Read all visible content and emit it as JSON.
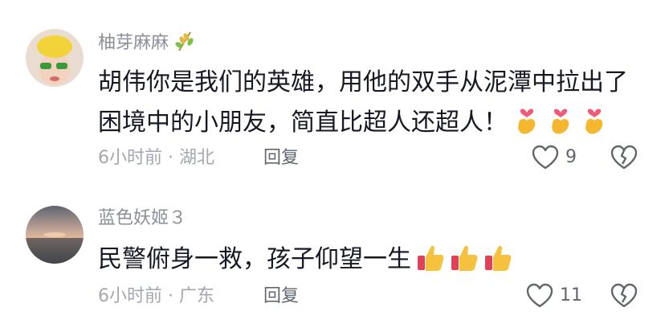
{
  "comments": [
    {
      "username": "柚芽麻麻",
      "badge_icon": "rice-ear-icon",
      "text": "胡伟你是我们的英雄，用他的双手从泥潭中拉出了困境中的小朋友，简直比超人还超人！",
      "emojis": [
        "finger-heart-emoji",
        "finger-heart-emoji",
        "finger-heart-emoji"
      ],
      "time": "6小时前",
      "separator": "·",
      "location": "湖北",
      "reply_label": "回复",
      "likes": "9"
    },
    {
      "username": "蓝色妖姬３",
      "text": "民警俯身一救，孩子仰望一生",
      "emojis": [
        "thumbs-up-emoji",
        "thumbs-up-emoji",
        "thumbs-up-emoji"
      ],
      "time": "6小时前",
      "separator": "·",
      "location": "广东",
      "reply_label": "回复",
      "likes": "11"
    }
  ]
}
